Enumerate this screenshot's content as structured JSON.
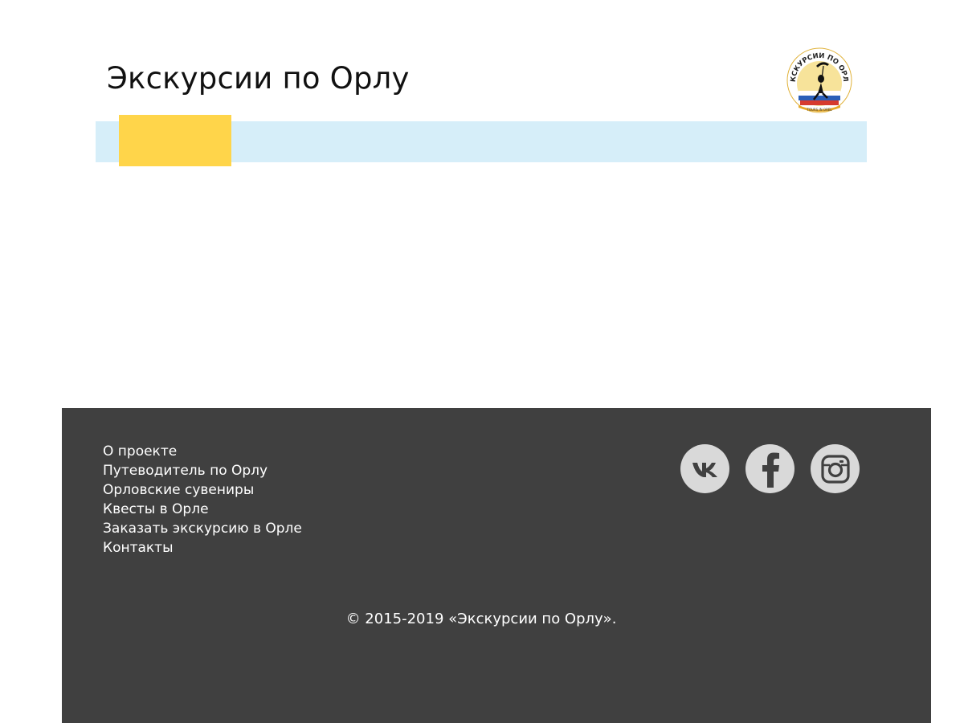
{
  "header": {
    "title": "Экскурсии по Орлу",
    "logo": {
      "icon": "excursion-logo",
      "text": "ЭКСКУРСИИ ПО ОРЛУ",
      "subtext": "TOURS IN OREL"
    }
  },
  "nav": {
    "active_color": "#ffd54a",
    "bar_color": "#d6eef9"
  },
  "footer": {
    "links": [
      "О проекте",
      "Путеводитель по Орлу",
      "Орловские сувениры",
      "Квесты в Орле",
      "Заказать экскурсию в Орле",
      "Контакты"
    ],
    "social": [
      {
        "icon": "vk-icon"
      },
      {
        "icon": "facebook-icon"
      },
      {
        "icon": "instagram-icon"
      }
    ],
    "copyright": "© 2015-2019 «Экскурсии по Орлу».",
    "background": "#404040"
  }
}
